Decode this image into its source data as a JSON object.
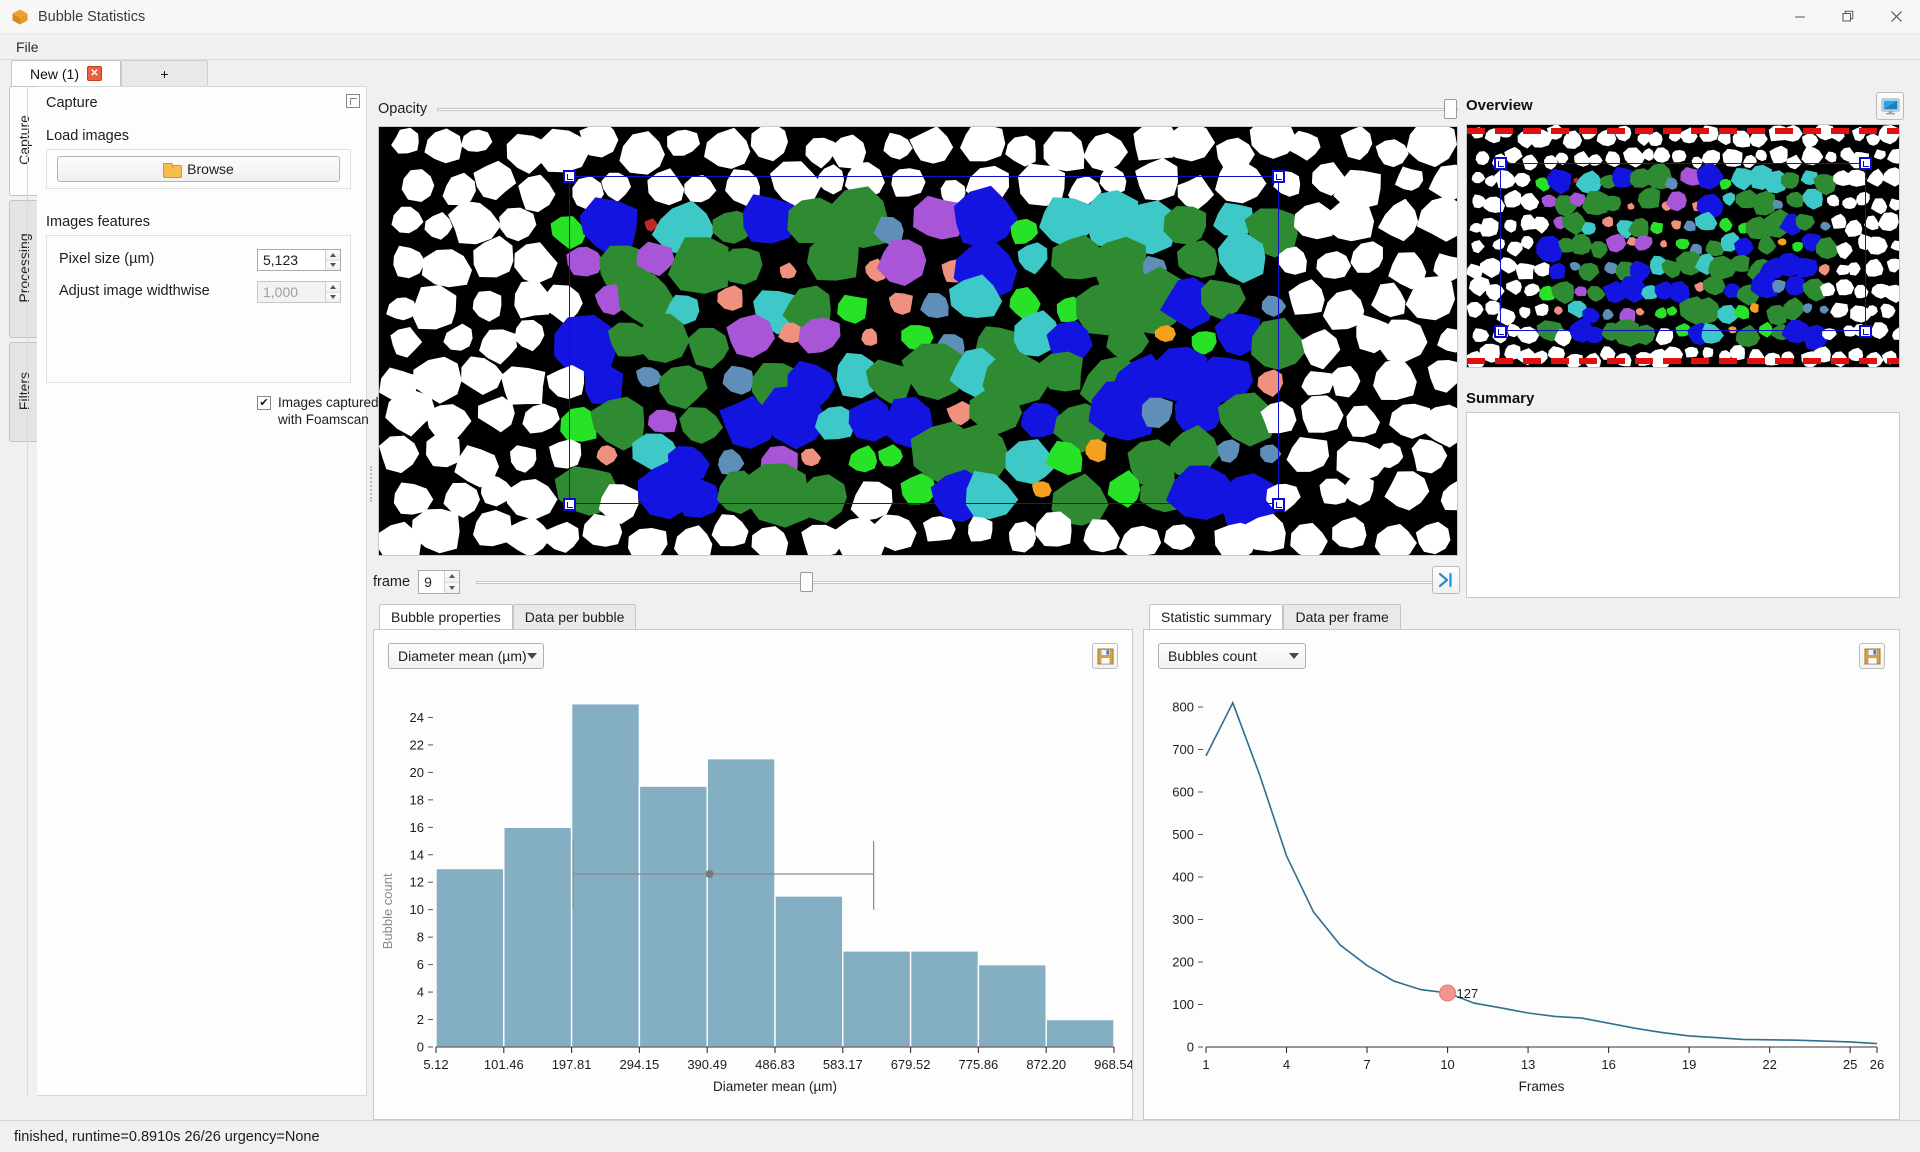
{
  "window": {
    "title": "Bubble Statistics",
    "app_icon": "package-icon",
    "minimize": "–",
    "restore": "❐",
    "close": "✕"
  },
  "menubar": {
    "items": [
      "File"
    ]
  },
  "doc_tabs": {
    "active": {
      "label": "New (1)",
      "close": "✕"
    },
    "add": {
      "label": "+"
    }
  },
  "vtabs": [
    {
      "label": "Capture",
      "active": true
    },
    {
      "label": "Processing",
      "active": false
    },
    {
      "label": "Filters",
      "active": false
    }
  ],
  "capture": {
    "title": "Capture",
    "load_images_label": "Load images",
    "browse_label": "Browse",
    "images_features_label": "Images features",
    "pixel_size_label": "Pixel size (µm)",
    "pixel_size_value": "5,123",
    "adjust_width_label": "Adjust image widthwise",
    "adjust_width_value": "1,000",
    "foamscan_checkbox_label": "Images captured\nwith Foamscan",
    "foamscan_checked": "✔"
  },
  "opacity": {
    "label": "Opacity",
    "value": 100
  },
  "frame": {
    "label": "frame",
    "value": "9",
    "slider_percent": 33,
    "jump_icon": "skip-to-end-icon"
  },
  "overview": {
    "title": "Overview",
    "button_icon": "monitor-icon"
  },
  "summary": {
    "title": "Summary",
    "content": ""
  },
  "left_chart": {
    "tabs": [
      {
        "label": "Bubble properties",
        "active": true
      },
      {
        "label": "Data per bubble",
        "active": false
      }
    ],
    "combo_value": "Diameter mean (µm)",
    "save_icon": "save-icon"
  },
  "right_chart": {
    "tabs": [
      {
        "label": "Statistic summary",
        "active": true
      },
      {
        "label": "Data per frame",
        "active": false
      }
    ],
    "combo_value": "Bubbles count",
    "save_icon": "save-icon"
  },
  "statusbar": {
    "text": "finished, runtime=0.8910s 26/26 urgency=None"
  },
  "colors": {
    "bar_fill": "#84aec2",
    "line_stroke": "#2f6f8f",
    "marker_fill": "#f0968f",
    "selection": "#1111cc",
    "overview_dash": "#e01010"
  },
  "chart_data": [
    {
      "type": "bar",
      "id": "bubble-properties-histogram",
      "title": "",
      "xlabel": "Diameter mean (µm)",
      "ylabel": "Bubble count",
      "categories": [
        "5.12",
        "101.46",
        "197.81",
        "294.15",
        "390.49",
        "486.83",
        "583.17",
        "679.52",
        "775.86",
        "872.20",
        "968.54"
      ],
      "tick_labels": [
        "5.12",
        "101.46",
        "197.81",
        "294.15",
        "390.49",
        "486.83",
        "583.17",
        "679.52",
        "775.86",
        "872.20",
        "968.54"
      ],
      "values": [
        13,
        16,
        25,
        19,
        21,
        11,
        7,
        7,
        6,
        2
      ],
      "bin_edges": [
        5.12,
        101.46,
        197.81,
        294.15,
        390.49,
        486.83,
        583.17,
        679.52,
        775.86,
        872.2,
        968.54
      ],
      "ytick_labels": [
        "0",
        "2",
        "4",
        "6",
        "8",
        "10",
        "12",
        "14",
        "16",
        "18",
        "20",
        "22",
        "24"
      ],
      "ylim": [
        0,
        26
      ],
      "xlim": [
        5.12,
        968.54
      ],
      "grid": false,
      "legend": "none",
      "annotations": {
        "mean_marker": 12.6,
        "mean_x": 394.0,
        "errorbar_low_x": 200.0,
        "errorbar_high_x": 627.0,
        "errorbar_y": 12.6,
        "whisker_low_span": [
          10.0,
          15.0
        ],
        "whisker_high_span": [
          10.0,
          15.0
        ]
      }
    },
    {
      "type": "line",
      "id": "statistic-summary-line",
      "title": "",
      "xlabel": "Frames",
      "ylabel": "",
      "xtick_labels": [
        "1",
        "4",
        "7",
        "10",
        "13",
        "16",
        "19",
        "22",
        "25",
        "26"
      ],
      "ytick_labels": [
        "0",
        "100",
        "200",
        "300",
        "400",
        "500",
        "600",
        "700",
        "800"
      ],
      "xlim": [
        1,
        26
      ],
      "ylim": [
        0,
        840
      ],
      "grid": false,
      "legend": "none",
      "x": [
        1,
        2,
        3,
        4,
        5,
        6,
        7,
        8,
        9,
        10,
        11,
        12,
        13,
        14,
        15,
        16,
        17,
        18,
        19,
        20,
        21,
        22,
        23,
        24,
        25,
        26
      ],
      "values": [
        685,
        810,
        640,
        450,
        318,
        240,
        192,
        155,
        135,
        127,
        103,
        92,
        80,
        72,
        68,
        56,
        44,
        34,
        26,
        22,
        18,
        17,
        16,
        14,
        12,
        8
      ],
      "highlight": {
        "x": 10,
        "y": 127,
        "label": "127"
      }
    }
  ]
}
